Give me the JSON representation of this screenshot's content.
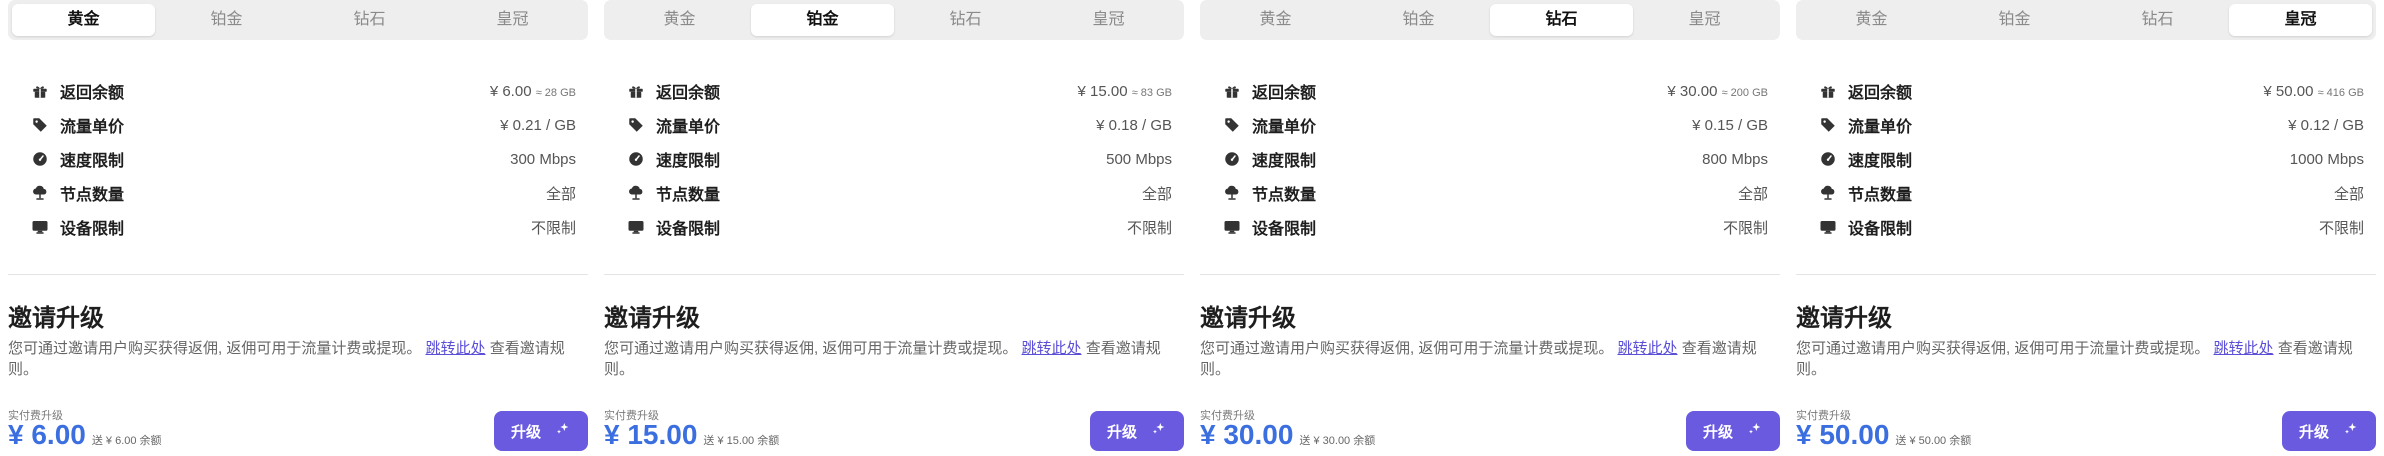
{
  "tabs": [
    "黄金",
    "铂金",
    "钻石",
    "皇冠"
  ],
  "features": [
    {
      "label": "返回余额",
      "icon": "gift-icon"
    },
    {
      "label": "流量单价",
      "icon": "tag-icon"
    },
    {
      "label": "速度限制",
      "icon": "speedometer-icon"
    },
    {
      "label": "节点数量",
      "icon": "cloud-node-icon"
    },
    {
      "label": "设备限制",
      "icon": "monitor-icon"
    }
  ],
  "invite": {
    "title": "邀请升级",
    "desc_before": "您可通过邀请用户购买获得返佣, 返佣可用于流量计费或提现。",
    "link": "跳转此处",
    "desc_after": "查看邀请规则。"
  },
  "paid_label": "实付费升级",
  "upgrade_label": "升级",
  "colors": {
    "accent": "#6a5ae0",
    "price": "#3b6fe0",
    "link": "#5b4fd6"
  },
  "plans": [
    {
      "active_tab": 0,
      "balance": "¥ 6.00",
      "balance_sub": "≈ 28 GB",
      "unit_price": "¥ 0.21 / GB",
      "speed": "300 Mbps",
      "nodes": "全部",
      "devices": "不限制",
      "price": "¥ 6.00",
      "bonus": "送 ¥ 6.00 余额"
    },
    {
      "active_tab": 1,
      "balance": "¥ 15.00",
      "balance_sub": "≈ 83 GB",
      "unit_price": "¥ 0.18 / GB",
      "speed": "500 Mbps",
      "nodes": "全部",
      "devices": "不限制",
      "price": "¥ 15.00",
      "bonus": "送 ¥ 15.00 余额"
    },
    {
      "active_tab": 2,
      "balance": "¥ 30.00",
      "balance_sub": "≈ 200 GB",
      "unit_price": "¥ 0.15 / GB",
      "speed": "800 Mbps",
      "nodes": "全部",
      "devices": "不限制",
      "price": "¥ 30.00",
      "bonus": "送 ¥ 30.00 余额"
    },
    {
      "active_tab": 3,
      "balance": "¥ 50.00",
      "balance_sub": "≈ 416 GB",
      "unit_price": "¥ 0.12 / GB",
      "speed": "1000 Mbps",
      "nodes": "全部",
      "devices": "不限制",
      "price": "¥ 50.00",
      "bonus": "送 ¥ 50.00 余额"
    }
  ]
}
